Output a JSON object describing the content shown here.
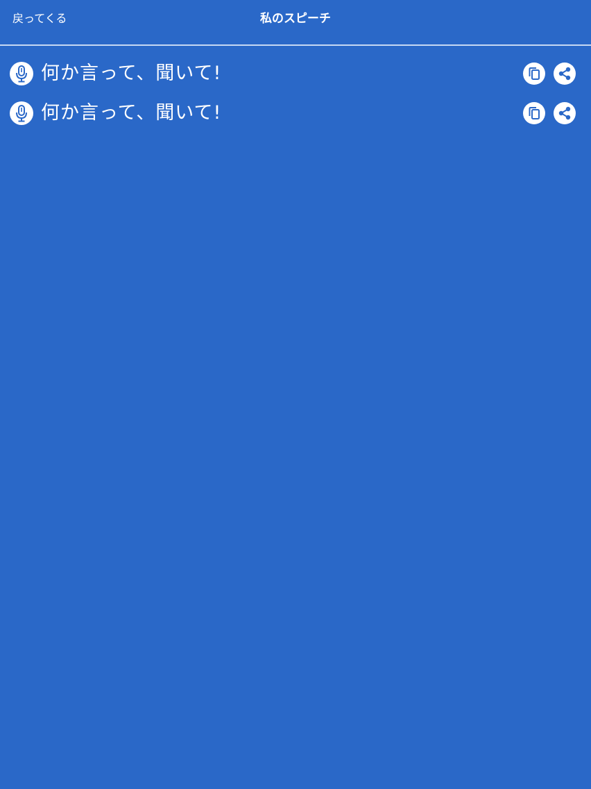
{
  "nav": {
    "back_label": "戻ってくる",
    "title": "私のスピーチ"
  },
  "speeches": [
    {
      "text": "何か言って、聞いて!"
    },
    {
      "text": "何か言って、聞いて!"
    }
  ],
  "icons": {
    "mic": "mic-icon",
    "copy": "copy-icon",
    "share": "share-icon"
  },
  "colors": {
    "background": "#2a68c8",
    "foreground": "#ffffff",
    "divider": "#c6d8f3"
  }
}
